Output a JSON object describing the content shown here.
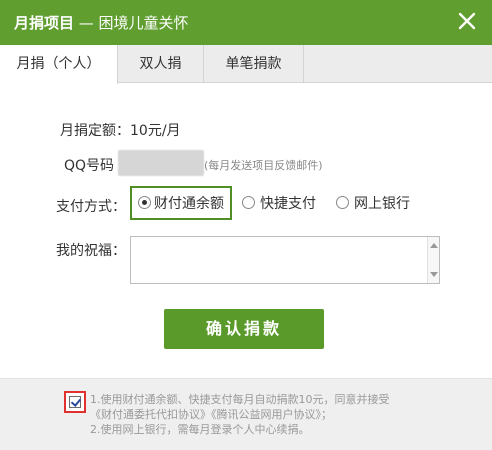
{
  "titlebar": {
    "title_bold": "月捐项目",
    "title_rest": " — 困境儿童关怀"
  },
  "tabs": [
    {
      "label": "月捐（个人）",
      "active": true
    },
    {
      "label": "双人捐",
      "active": false
    },
    {
      "label": "单笔捐款",
      "active": false
    }
  ],
  "form": {
    "amount_label": "月捐定额：",
    "amount_value": "10元/月",
    "qq_label": "QQ号码",
    "qq_hint": "(每月发送项目反馈邮件)",
    "pay_label": "支付方式：",
    "pay_options": [
      {
        "label": "财付通余额",
        "selected": true
      },
      {
        "label": "快捷支付",
        "selected": false
      },
      {
        "label": "网上银行",
        "selected": false
      }
    ],
    "wish_label": "我的祝福：",
    "wish_value": ""
  },
  "confirm_label": "确认捐款",
  "footer": {
    "agree_checked": true,
    "lines": [
      "1.使用财付通余额、快捷支付每月自动捐款10元，同意并接受",
      "《财付通委托代扣协议》《腾讯公益网用户协议》；",
      "2.使用网上银行，需每月登录个人中心续捐。"
    ]
  },
  "colors": {
    "brand_green": "#5f9e2f",
    "highlight_red": "#e0312e"
  }
}
